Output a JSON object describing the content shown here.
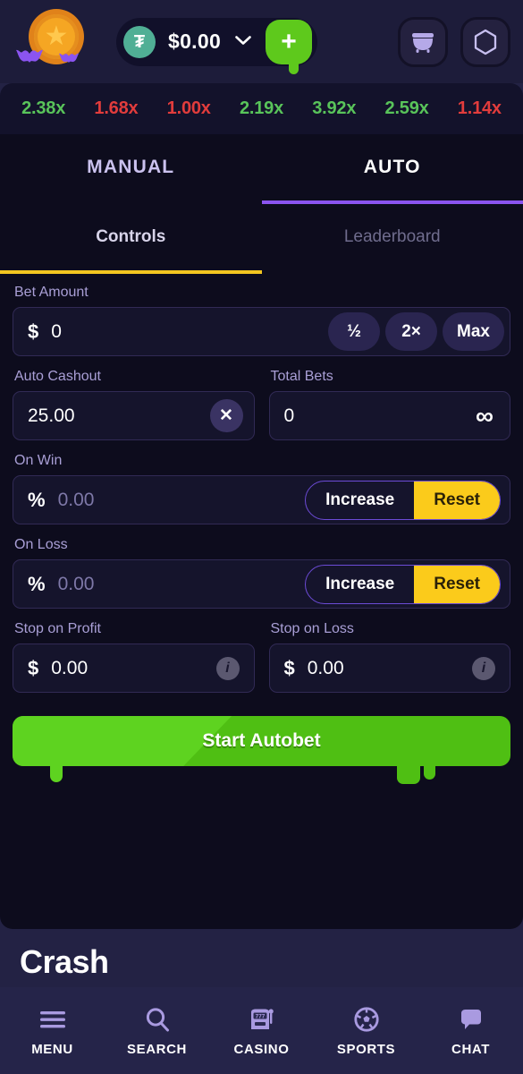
{
  "header": {
    "logo_name": "halloween-coin-bats-logo",
    "balance": {
      "currency_icon": "usdt-tether-icon",
      "currency_symbol": "₮",
      "amount": "$0.00",
      "chevron": "▼"
    },
    "deposit_label": "+",
    "buttons": [
      {
        "name": "cauldron-button",
        "icon": "cauldron-icon"
      },
      {
        "name": "hexagon-button",
        "icon": "hexagon-icon"
      }
    ]
  },
  "history": {
    "items": [
      {
        "value": "2.38x",
        "color": "#59c45a"
      },
      {
        "value": "1.68x",
        "color": "#e23c3c"
      },
      {
        "value": "1.00x",
        "color": "#e23c3c"
      },
      {
        "value": "2.19x",
        "color": "#59c45a"
      },
      {
        "value": "3.92x",
        "color": "#59c45a"
      },
      {
        "value": "2.59x",
        "color": "#59c45a"
      },
      {
        "value": "1.14x",
        "color": "#e23c3c"
      }
    ]
  },
  "mode_tabs": [
    {
      "label": "MANUAL",
      "active": false
    },
    {
      "label": "AUTO",
      "active": true
    }
  ],
  "sub_tabs": [
    {
      "label": "Controls",
      "active": true
    },
    {
      "label": "Leaderboard",
      "active": false
    }
  ],
  "controls": {
    "bet_amount": {
      "label": "Bet Amount",
      "symbol": "$",
      "value": "0",
      "chips": [
        "½",
        "2×",
        "Max"
      ]
    },
    "auto_cashout": {
      "label": "Auto Cashout",
      "value": "25.00",
      "clear_icon": "✕"
    },
    "total_bets": {
      "label": "Total Bets",
      "value": "0",
      "infinity_icon": "∞"
    },
    "on_win": {
      "label": "On Win",
      "symbol": "%",
      "value": "0.00",
      "options": [
        "Increase",
        "Reset"
      ],
      "selected": "Reset"
    },
    "on_loss": {
      "label": "On Loss",
      "symbol": "%",
      "value": "0.00",
      "options": [
        "Increase",
        "Reset"
      ],
      "selected": "Reset"
    },
    "stop_on_profit": {
      "label": "Stop on Profit",
      "symbol": "$",
      "value": "0.00",
      "info_icon": "i"
    },
    "stop_on_loss": {
      "label": "Stop on Loss",
      "symbol": "$",
      "value": "0.00",
      "info_icon": "i"
    },
    "start_button": "Start Autobet"
  },
  "game": {
    "title": "Crash"
  },
  "bottom_nav": [
    {
      "label": "MENU",
      "icon": "hamburger-menu-icon"
    },
    {
      "label": "SEARCH",
      "icon": "search-icon"
    },
    {
      "label": "CASINO",
      "icon": "slot-machine-icon"
    },
    {
      "label": "SPORTS",
      "icon": "soccer-ball-icon"
    },
    {
      "label": "CHAT",
      "icon": "chat-bubble-icon"
    }
  ],
  "colors": {
    "accent_purple": "#8b54f0",
    "accent_yellow": "#f3c620",
    "positive_green": "#59c45a",
    "negative_red": "#e23c3c",
    "action_green": "#4fbf13"
  }
}
